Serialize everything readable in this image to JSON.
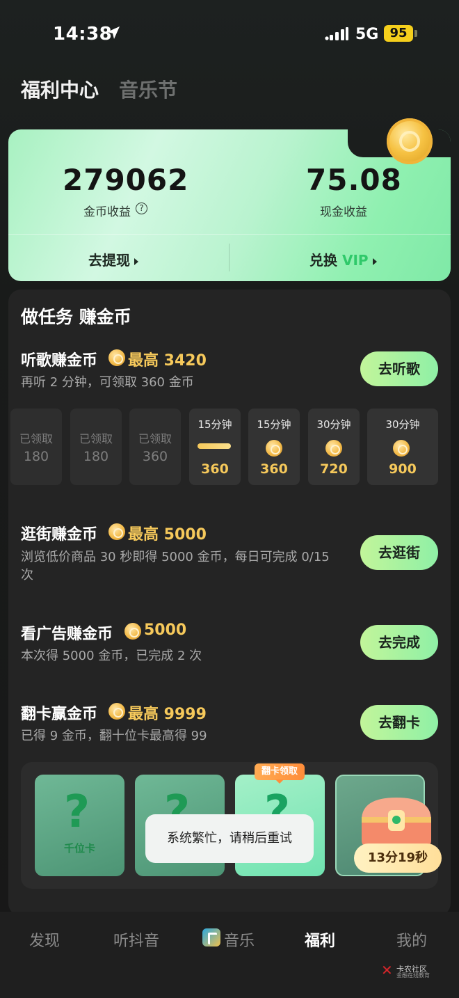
{
  "status_bar": {
    "time": "14:38",
    "network": "5G",
    "battery": "95"
  },
  "header": {
    "tabs": [
      {
        "label": "福利中心",
        "active": true
      },
      {
        "label": "音乐节",
        "active": false
      }
    ]
  },
  "earnings": {
    "coins": "279062",
    "coins_label": "金币收益",
    "cash": "75.08",
    "cash_label": "现金收益",
    "withdraw_label": "去提现",
    "exchange_label": "兑换",
    "vip_label": "VIP"
  },
  "tasks": {
    "section_title": "做任务 赚金币",
    "listen": {
      "title": "听歌赚金币",
      "reward": "最高 3420",
      "desc": "再听 2 分钟，可领取 360 金币",
      "button": "去听歌",
      "slots": [
        {
          "top": "已领取",
          "value": "180"
        },
        {
          "top": "已领取",
          "value": "180"
        },
        {
          "top": "已领取",
          "value": "360"
        },
        {
          "top": "15分钟",
          "value": "360",
          "progress": 0.9
        },
        {
          "top": "15分钟",
          "value": "360"
        },
        {
          "top": "30分钟",
          "value": "720"
        },
        {
          "top": "30分钟",
          "value": "900"
        }
      ]
    },
    "shopping": {
      "title": "逛街赚金币",
      "reward": "最高 5000",
      "desc_line1": "浏览低价商品 30 秒即得 5000 金币，每日可完成 0/15",
      "desc_line2": "次",
      "button": "去逛街"
    },
    "ads": {
      "title": "看广告赚金币",
      "reward": "5000",
      "desc": "本次得 5000 金币，已完成 2 次",
      "button": "去完成"
    },
    "flip": {
      "title": "翻卡赢金币",
      "reward": "最高 9999",
      "desc": "已得 9 金币，翻十位卡最高得 99",
      "button": "去翻卡",
      "card1_label": "千位卡",
      "badge": "翻卡领取",
      "qmark": "?",
      "timer": "13分19秒"
    }
  },
  "toast": {
    "message": "系统繁忙，请稍后重试"
  },
  "bottom_nav": {
    "items": [
      {
        "label": "发现",
        "active": false
      },
      {
        "label": "听抖音",
        "active": false
      },
      {
        "label": "音乐",
        "active": false
      },
      {
        "label": "福利",
        "active": true
      },
      {
        "label": "我的",
        "active": false
      }
    ]
  },
  "watermark": {
    "text": "卡农社区",
    "sub": "金融在线教育"
  },
  "colors": {
    "accent_green": "#8ff0a6",
    "coin_gold": "#f6c95b",
    "vip_green": "#2fc96a",
    "badge_orange": "#ff8d3a"
  }
}
